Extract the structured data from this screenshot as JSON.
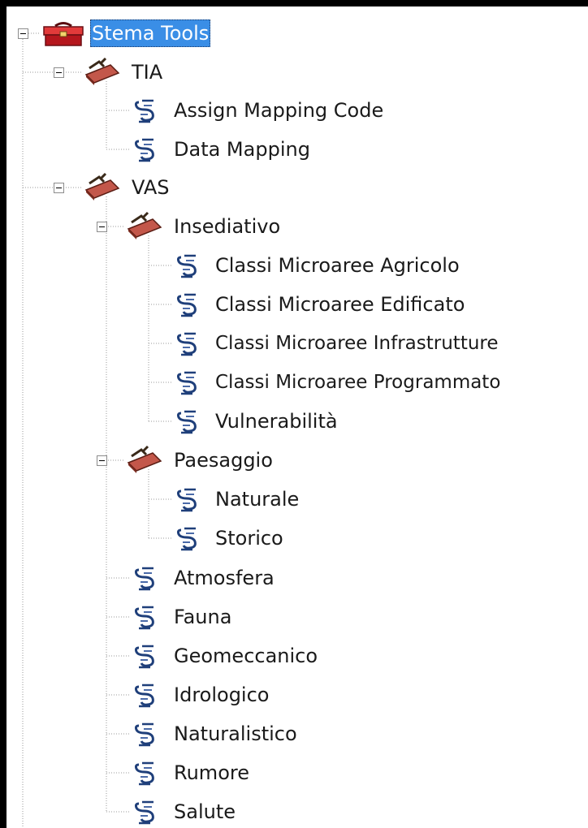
{
  "tree": {
    "root": {
      "label": "Stema Tools",
      "icon": "red-toolbox-icon",
      "selected": true,
      "expanded": true
    },
    "tia": {
      "label": "TIA",
      "icon": "toolset-icon",
      "expanded": true,
      "items": [
        {
          "label": "Assign Mapping Code",
          "icon": "script-tool-icon"
        },
        {
          "label": "Data Mapping",
          "icon": "script-tool-icon"
        }
      ]
    },
    "vas": {
      "label": "VAS",
      "icon": "toolset-icon",
      "expanded": true,
      "insediativo": {
        "label": "Insediativo",
        "icon": "toolset-icon",
        "expanded": true,
        "items": [
          {
            "label": "Classi Microaree Agricolo",
            "icon": "script-tool-icon"
          },
          {
            "label": "Classi Microaree Edificato",
            "icon": "script-tool-icon"
          },
          {
            "label": "Classi Microaree Infrastrutture",
            "icon": "script-tool-icon"
          },
          {
            "label": "Classi Microaree Programmato",
            "icon": "script-tool-icon"
          },
          {
            "label": "Vulnerabilità",
            "icon": "script-tool-icon"
          }
        ]
      },
      "paesaggio": {
        "label": "Paesaggio",
        "icon": "toolset-icon",
        "expanded": true,
        "items": [
          {
            "label": "Naturale",
            "icon": "script-tool-icon"
          },
          {
            "label": "Storico",
            "icon": "script-tool-icon"
          }
        ]
      },
      "items": [
        {
          "label": "Atmosfera",
          "icon": "script-tool-icon"
        },
        {
          "label": "Fauna",
          "icon": "script-tool-icon"
        },
        {
          "label": "Geomeccanico",
          "icon": "script-tool-icon"
        },
        {
          "label": "Idrologico",
          "icon": "script-tool-icon"
        },
        {
          "label": "Naturalistico",
          "icon": "script-tool-icon"
        },
        {
          "label": "Rumore",
          "icon": "script-tool-icon"
        },
        {
          "label": "Salute",
          "icon": "script-tool-icon"
        }
      ]
    }
  },
  "colors": {
    "selection": "#3a8ee6",
    "toolbox_red": "#c8202a",
    "toolset_brown": "#8a3b2a",
    "script_blue": "#1f3f7a"
  }
}
